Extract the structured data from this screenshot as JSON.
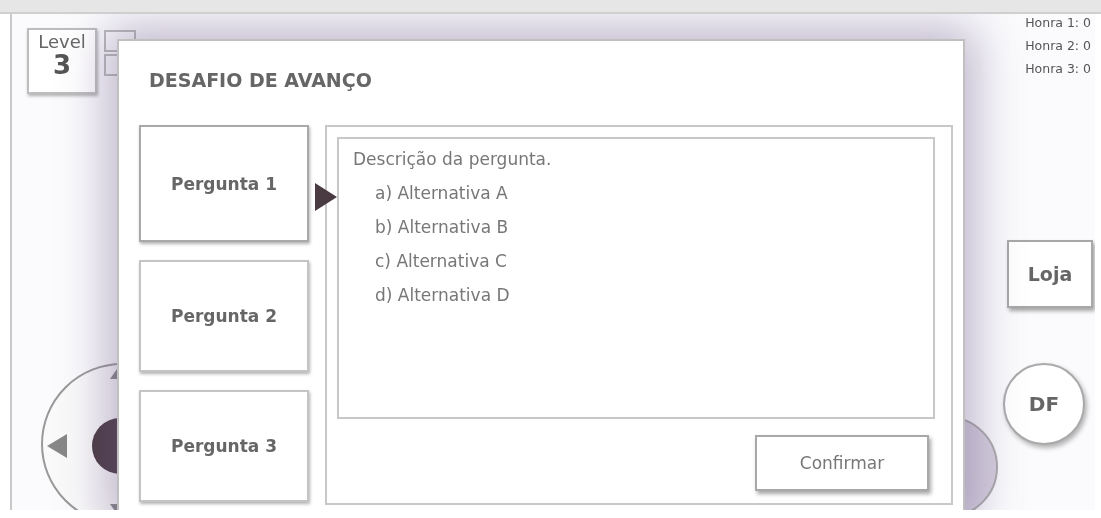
{
  "hud": {
    "level_label": "Level",
    "level_value": "3",
    "honor": [
      "Honra 1: 0",
      "Honra 2: 0",
      "Honra 3: 0"
    ],
    "shop_button": "Loja",
    "df_button": "DF"
  },
  "dialog": {
    "title": "DESAFIO DE AVANÇO",
    "questions": [
      {
        "label": "Pergunta 1",
        "selected": true
      },
      {
        "label": "Pergunta 2",
        "selected": false
      },
      {
        "label": "Pergunta 3",
        "selected": false
      }
    ],
    "description": "Descrição da pergunta.",
    "alternatives": [
      "a) Alternativa A",
      "b) Alternativa B",
      "c) Alternativa C",
      "d) Alternativa D"
    ],
    "confirm_button": "Confirmar"
  }
}
